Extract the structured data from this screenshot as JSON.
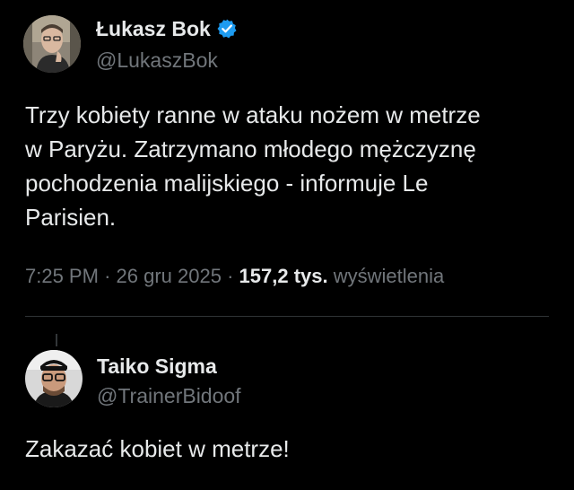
{
  "tweet": {
    "author": {
      "display_name": "Łukasz Bok",
      "handle": "@LukaszBok",
      "verified": true,
      "verified_color": "#1d9bf0"
    },
    "text_lines": [
      "Trzy kobiety ranne w ataku nożem w metrze",
      "w Paryżu. Zatrzymano młodego mężczyznę",
      "pochodzenia malijskiego - informuje Le",
      "Parisien."
    ],
    "time": "7:25 PM",
    "separator": "·",
    "date": "26 gru 2025",
    "views_count": "157,2 tys.",
    "views_label": "wyświetlenia"
  },
  "reply": {
    "author": {
      "display_name": "Taiko Sigma",
      "handle": "@TrainerBidoof"
    },
    "text": "Zakazać kobiet w metrze!"
  },
  "colors": {
    "background": "#000000",
    "primary_text": "#e7e9ea",
    "secondary_text": "#71767b",
    "divider": "#2f3336"
  }
}
